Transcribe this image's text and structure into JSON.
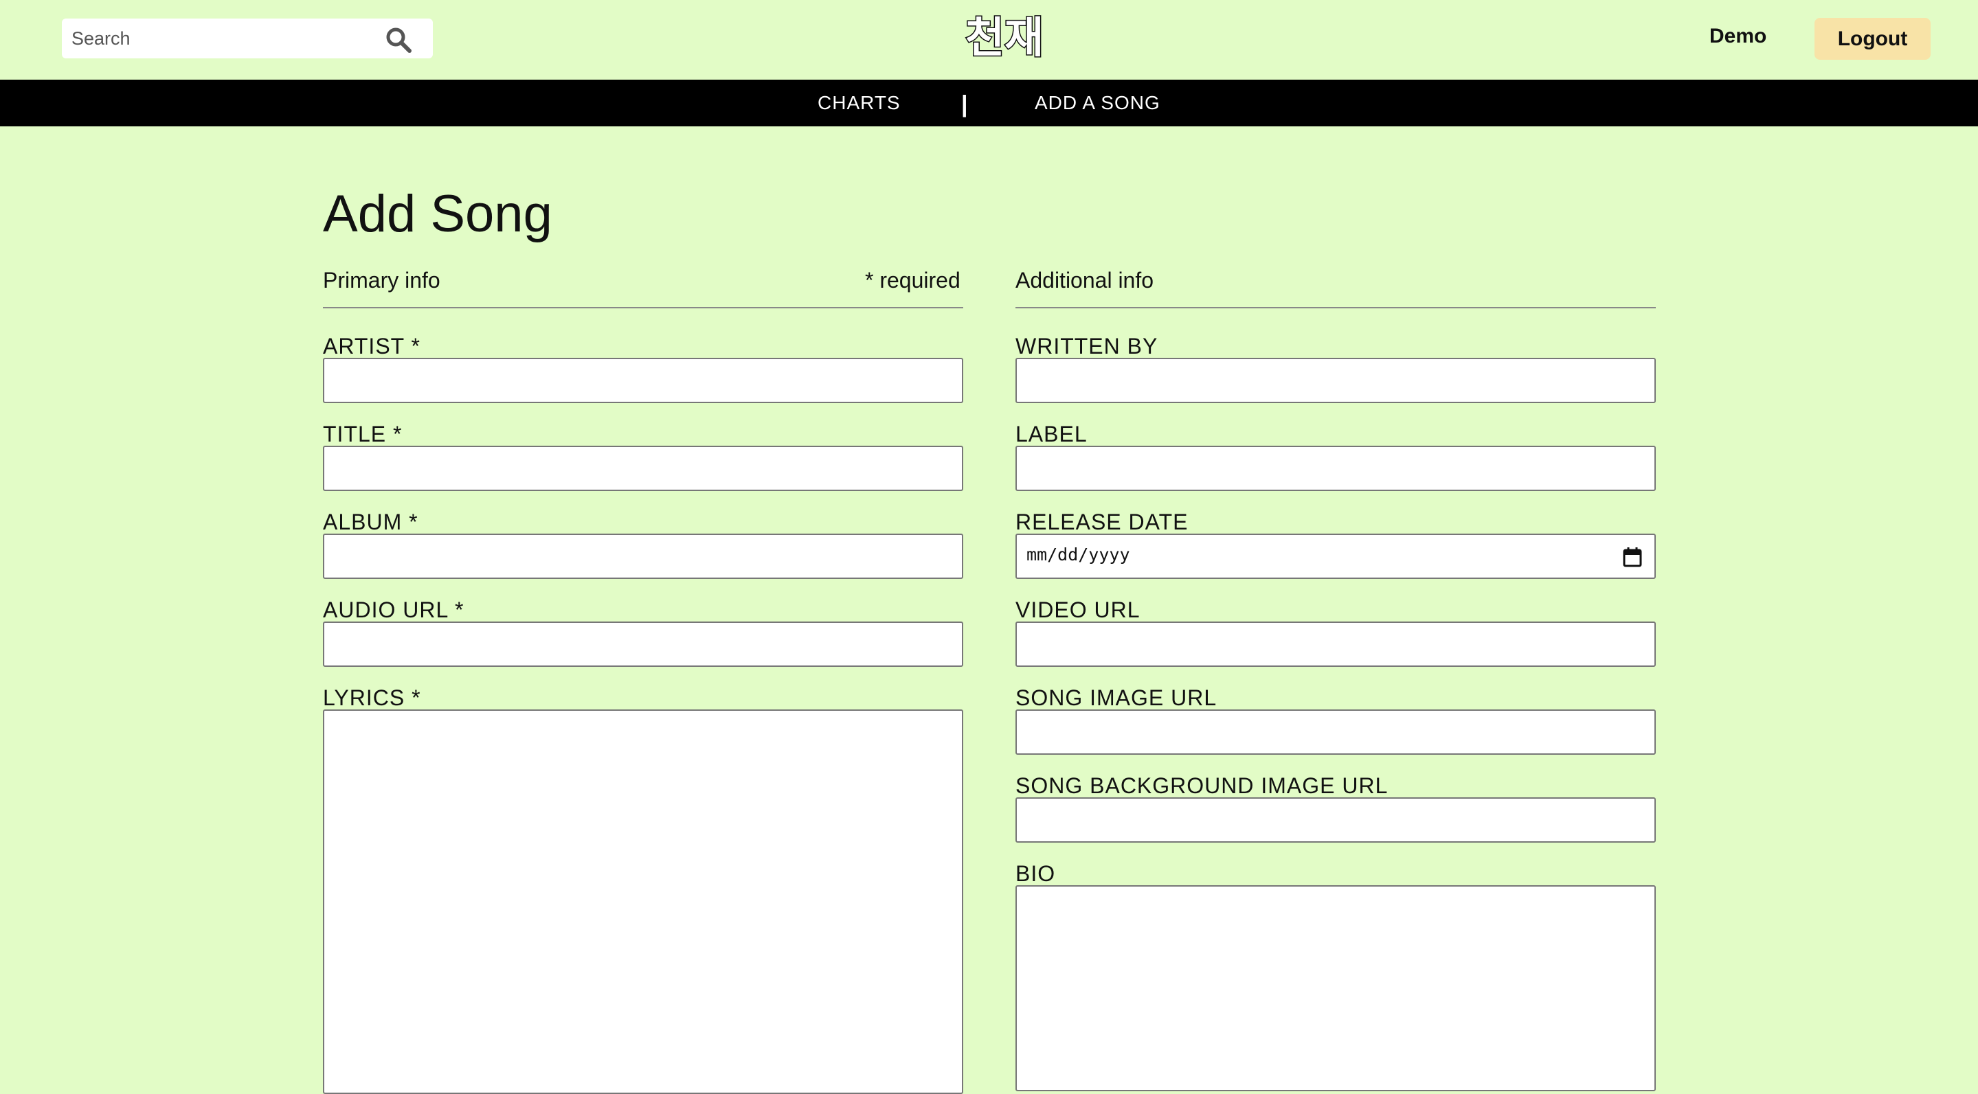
{
  "header": {
    "search_placeholder": "Search",
    "logo_text": "천재",
    "user_name": "Demo",
    "logout_label": "Logout"
  },
  "nav": {
    "charts": "CHARTS",
    "divider": "|",
    "add_song": "ADD A SONG"
  },
  "page": {
    "title": "Add Song"
  },
  "primary": {
    "heading": "Primary info",
    "required_note": "* required",
    "artist_label": "ARTIST *",
    "title_label": "TITLE *",
    "album_label": "ALBUM *",
    "audio_url_label": "AUDIO URL *",
    "lyrics_label": "LYRICS *"
  },
  "additional": {
    "heading": "Additional info",
    "written_by_label": "WRITTEN BY",
    "label_label": "LABEL",
    "release_date_label": "RELEASE DATE",
    "release_date_placeholder": "mm/dd/yyyy",
    "video_url_label": "VIDEO URL",
    "song_image_url_label": "SONG IMAGE URL",
    "song_bg_image_url_label": "SONG BACKGROUND IMAGE URL",
    "bio_label": "BIO"
  },
  "colors": {
    "background": "#e2fcc6",
    "navbar": "#000000",
    "logout_button": "#f8e3a7"
  },
  "icons": {
    "search": "search-icon",
    "calendar": "calendar-icon"
  }
}
